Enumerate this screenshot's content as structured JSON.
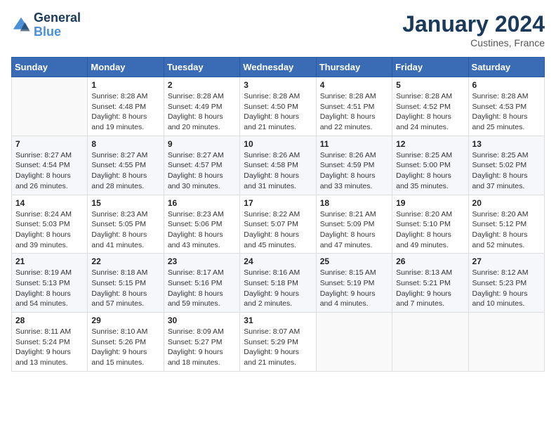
{
  "header": {
    "logo_line1": "General",
    "logo_line2": "Blue",
    "month": "January 2024",
    "location": "Custines, France"
  },
  "weekdays": [
    "Sunday",
    "Monday",
    "Tuesday",
    "Wednesday",
    "Thursday",
    "Friday",
    "Saturday"
  ],
  "weeks": [
    [
      {
        "day": "",
        "info": ""
      },
      {
        "day": "1",
        "info": "Sunrise: 8:28 AM\nSunset: 4:48 PM\nDaylight: 8 hours\nand 19 minutes."
      },
      {
        "day": "2",
        "info": "Sunrise: 8:28 AM\nSunset: 4:49 PM\nDaylight: 8 hours\nand 20 minutes."
      },
      {
        "day": "3",
        "info": "Sunrise: 8:28 AM\nSunset: 4:50 PM\nDaylight: 8 hours\nand 21 minutes."
      },
      {
        "day": "4",
        "info": "Sunrise: 8:28 AM\nSunset: 4:51 PM\nDaylight: 8 hours\nand 22 minutes."
      },
      {
        "day": "5",
        "info": "Sunrise: 8:28 AM\nSunset: 4:52 PM\nDaylight: 8 hours\nand 24 minutes."
      },
      {
        "day": "6",
        "info": "Sunrise: 8:28 AM\nSunset: 4:53 PM\nDaylight: 8 hours\nand 25 minutes."
      }
    ],
    [
      {
        "day": "7",
        "info": "Sunrise: 8:27 AM\nSunset: 4:54 PM\nDaylight: 8 hours\nand 26 minutes."
      },
      {
        "day": "8",
        "info": "Sunrise: 8:27 AM\nSunset: 4:55 PM\nDaylight: 8 hours\nand 28 minutes."
      },
      {
        "day": "9",
        "info": "Sunrise: 8:27 AM\nSunset: 4:57 PM\nDaylight: 8 hours\nand 30 minutes."
      },
      {
        "day": "10",
        "info": "Sunrise: 8:26 AM\nSunset: 4:58 PM\nDaylight: 8 hours\nand 31 minutes."
      },
      {
        "day": "11",
        "info": "Sunrise: 8:26 AM\nSunset: 4:59 PM\nDaylight: 8 hours\nand 33 minutes."
      },
      {
        "day": "12",
        "info": "Sunrise: 8:25 AM\nSunset: 5:00 PM\nDaylight: 8 hours\nand 35 minutes."
      },
      {
        "day": "13",
        "info": "Sunrise: 8:25 AM\nSunset: 5:02 PM\nDaylight: 8 hours\nand 37 minutes."
      }
    ],
    [
      {
        "day": "14",
        "info": "Sunrise: 8:24 AM\nSunset: 5:03 PM\nDaylight: 8 hours\nand 39 minutes."
      },
      {
        "day": "15",
        "info": "Sunrise: 8:23 AM\nSunset: 5:05 PM\nDaylight: 8 hours\nand 41 minutes."
      },
      {
        "day": "16",
        "info": "Sunrise: 8:23 AM\nSunset: 5:06 PM\nDaylight: 8 hours\nand 43 minutes."
      },
      {
        "day": "17",
        "info": "Sunrise: 8:22 AM\nSunset: 5:07 PM\nDaylight: 8 hours\nand 45 minutes."
      },
      {
        "day": "18",
        "info": "Sunrise: 8:21 AM\nSunset: 5:09 PM\nDaylight: 8 hours\nand 47 minutes."
      },
      {
        "day": "19",
        "info": "Sunrise: 8:20 AM\nSunset: 5:10 PM\nDaylight: 8 hours\nand 49 minutes."
      },
      {
        "day": "20",
        "info": "Sunrise: 8:20 AM\nSunset: 5:12 PM\nDaylight: 8 hours\nand 52 minutes."
      }
    ],
    [
      {
        "day": "21",
        "info": "Sunrise: 8:19 AM\nSunset: 5:13 PM\nDaylight: 8 hours\nand 54 minutes."
      },
      {
        "day": "22",
        "info": "Sunrise: 8:18 AM\nSunset: 5:15 PM\nDaylight: 8 hours\nand 57 minutes."
      },
      {
        "day": "23",
        "info": "Sunrise: 8:17 AM\nSunset: 5:16 PM\nDaylight: 8 hours\nand 59 minutes."
      },
      {
        "day": "24",
        "info": "Sunrise: 8:16 AM\nSunset: 5:18 PM\nDaylight: 9 hours\nand 2 minutes."
      },
      {
        "day": "25",
        "info": "Sunrise: 8:15 AM\nSunset: 5:19 PM\nDaylight: 9 hours\nand 4 minutes."
      },
      {
        "day": "26",
        "info": "Sunrise: 8:13 AM\nSunset: 5:21 PM\nDaylight: 9 hours\nand 7 minutes."
      },
      {
        "day": "27",
        "info": "Sunrise: 8:12 AM\nSunset: 5:23 PM\nDaylight: 9 hours\nand 10 minutes."
      }
    ],
    [
      {
        "day": "28",
        "info": "Sunrise: 8:11 AM\nSunset: 5:24 PM\nDaylight: 9 hours\nand 13 minutes."
      },
      {
        "day": "29",
        "info": "Sunrise: 8:10 AM\nSunset: 5:26 PM\nDaylight: 9 hours\nand 15 minutes."
      },
      {
        "day": "30",
        "info": "Sunrise: 8:09 AM\nSunset: 5:27 PM\nDaylight: 9 hours\nand 18 minutes."
      },
      {
        "day": "31",
        "info": "Sunrise: 8:07 AM\nSunset: 5:29 PM\nDaylight: 9 hours\nand 21 minutes."
      },
      {
        "day": "",
        "info": ""
      },
      {
        "day": "",
        "info": ""
      },
      {
        "day": "",
        "info": ""
      }
    ]
  ]
}
